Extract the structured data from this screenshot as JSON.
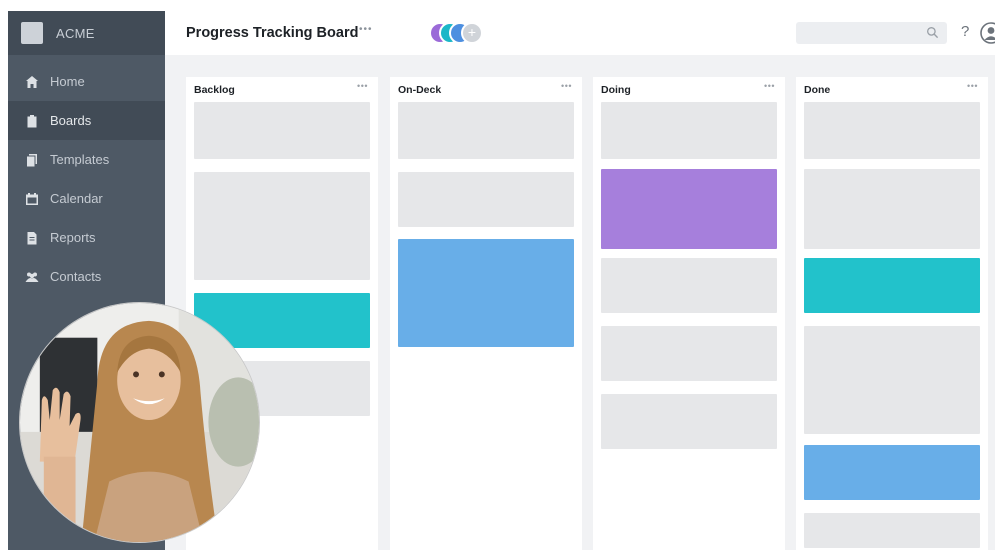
{
  "brand": {
    "name": "ACME",
    "logo_icon": "acme-logo-icon"
  },
  "sidebar": {
    "items": [
      {
        "label": "Home",
        "icon": "home-icon",
        "active": false
      },
      {
        "label": "Boards",
        "icon": "clipboard-icon",
        "active": true
      },
      {
        "label": "Templates",
        "icon": "templates-icon",
        "active": false
      },
      {
        "label": "Calendar",
        "icon": "calendar-icon",
        "active": false
      },
      {
        "label": "Reports",
        "icon": "reports-icon",
        "active": false
      },
      {
        "label": "Contacts",
        "icon": "contacts-icon",
        "active": false
      }
    ]
  },
  "header": {
    "title": "Progress Tracking Board",
    "title_more": "•••",
    "add_member": "+",
    "help": "?",
    "search_placeholder": ""
  },
  "columns": [
    {
      "title": "Backlog",
      "more": "•••",
      "cards": [
        "gray",
        "gray",
        "teal",
        "gray"
      ]
    },
    {
      "title": "On-Deck",
      "more": "•••",
      "cards": [
        "gray",
        "gray",
        "blue"
      ]
    },
    {
      "title": "Doing",
      "more": "•••",
      "cards": [
        "gray",
        "purple",
        "gray",
        "gray",
        "gray"
      ]
    },
    {
      "title": "Done",
      "more": "•••",
      "cards": [
        "gray",
        "gray",
        "teal",
        "gray",
        "blue",
        "gray"
      ]
    }
  ],
  "colors": {
    "sidebar": "#4e5965",
    "sidebar_active": "#414b56",
    "card_gray": "#e6e7e9",
    "card_teal": "#22c2cb",
    "card_blue": "#68aee8",
    "card_purple": "#a67fdc",
    "board_bg": "#f1f2f4"
  }
}
